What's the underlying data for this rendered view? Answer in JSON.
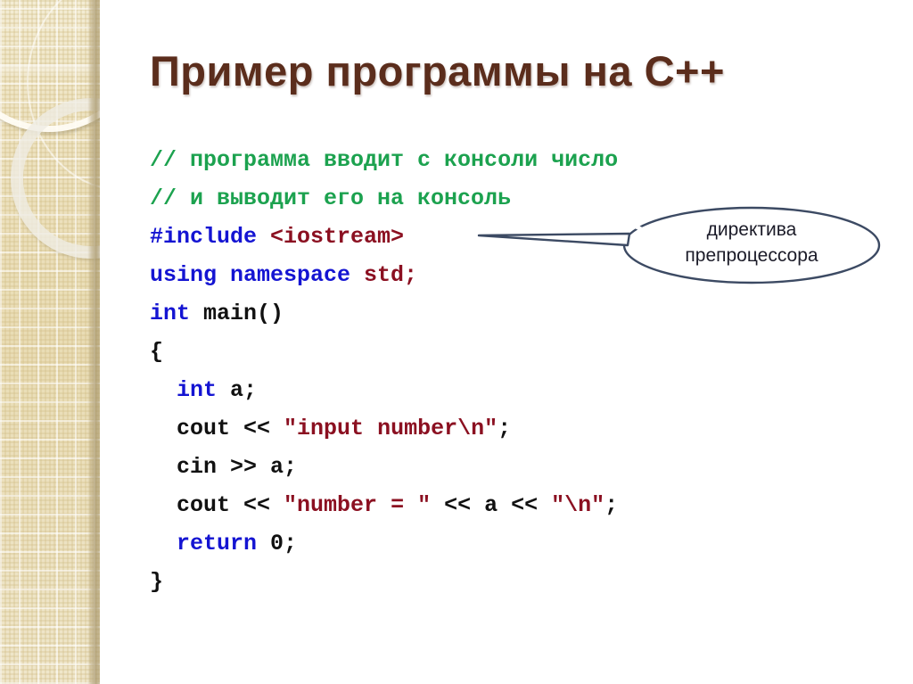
{
  "slide": {
    "title": "Пример программы на C++",
    "background_color": "#ffffff"
  },
  "sidebar": {
    "decoration": "beige-patterned-band-with-rings",
    "base_color": "#e9dcb4",
    "edge_color": "#a6946 7"
  },
  "theme": {
    "title_color": "#5b2d1c",
    "comment_color": "#1ca24f",
    "keyword_color": "#1414d2",
    "string_color": "#8b1021",
    "plain_color": "#111111",
    "callout_stroke": "#3c4a63",
    "callout_text_color": "#1b1b28"
  },
  "code": {
    "language": "C++",
    "lines": [
      {
        "indent": 0,
        "tokens": [
          {
            "t": "// программа вводит с консоли число",
            "k": "comment"
          }
        ]
      },
      {
        "indent": 0,
        "tokens": [
          {
            "t": "// и выводит его на консоль",
            "k": "comment"
          }
        ]
      },
      {
        "indent": 0,
        "tokens": [
          {
            "t": "#include ",
            "k": "keyword"
          },
          {
            "t": "<iostream>",
            "k": "string"
          }
        ]
      },
      {
        "indent": 0,
        "tokens": [
          {
            "t": "using namespace ",
            "k": "keyword"
          },
          {
            "t": "std;",
            "k": "string"
          }
        ]
      },
      {
        "indent": 0,
        "tokens": [
          {
            "t": "int ",
            "k": "keyword"
          },
          {
            "t": "main()",
            "k": "plain"
          }
        ]
      },
      {
        "indent": 0,
        "tokens": [
          {
            "t": "{",
            "k": "plain"
          }
        ]
      },
      {
        "indent": 2,
        "tokens": [
          {
            "t": "int ",
            "k": "keyword"
          },
          {
            "t": "a;",
            "k": "plain"
          }
        ]
      },
      {
        "indent": 2,
        "tokens": [
          {
            "t": "cout << ",
            "k": "plain"
          },
          {
            "t": "\"input number\\n\"",
            "k": "string"
          },
          {
            "t": ";",
            "k": "plain"
          }
        ]
      },
      {
        "indent": 2,
        "tokens": [
          {
            "t": "cin >> a;",
            "k": "plain"
          }
        ]
      },
      {
        "indent": 2,
        "tokens": [
          {
            "t": "cout << ",
            "k": "plain"
          },
          {
            "t": "\"number = \"",
            "k": "string"
          },
          {
            "t": " << a << ",
            "k": "plain"
          },
          {
            "t": "\"\\n\"",
            "k": "string"
          },
          {
            "t": ";",
            "k": "plain"
          }
        ]
      },
      {
        "indent": 2,
        "tokens": [
          {
            "t": "return ",
            "k": "keyword"
          },
          {
            "t": "0;",
            "k": "plain"
          }
        ]
      },
      {
        "indent": 0,
        "tokens": [
          {
            "t": "}",
            "k": "plain"
          }
        ]
      }
    ]
  },
  "callout": {
    "line1": "директива",
    "line2": "препроцессора",
    "points_to": "#include <iostream>",
    "shape": "ellipse-with-tail"
  }
}
